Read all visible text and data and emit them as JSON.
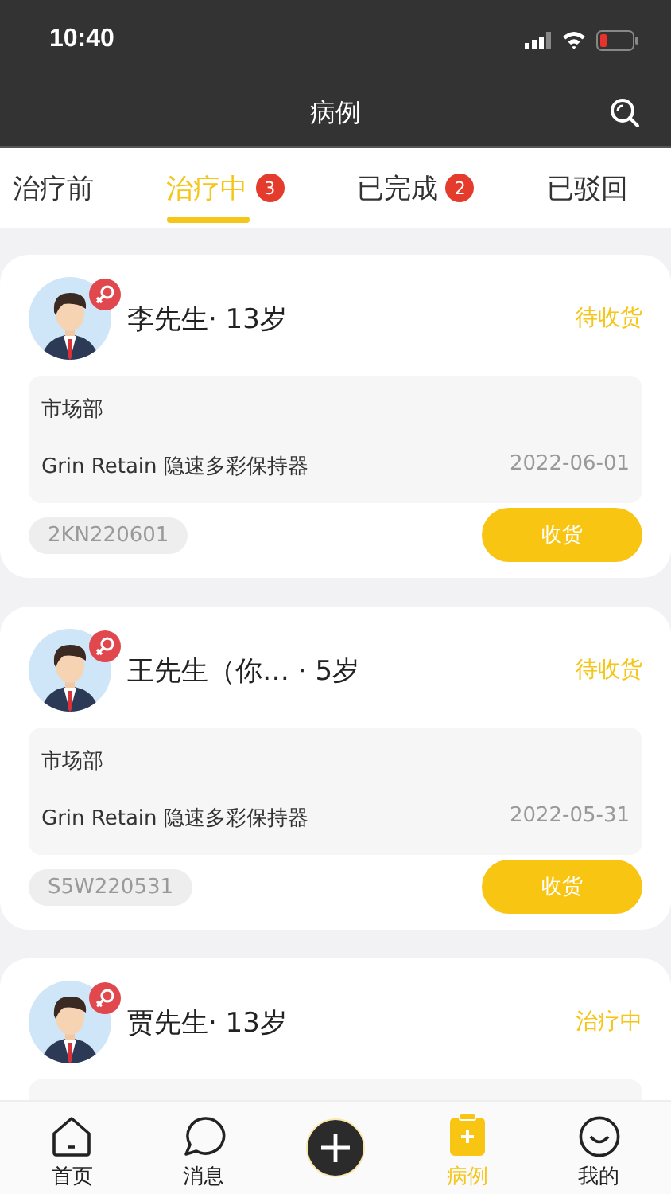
{
  "status_bar": {
    "time": "10:40"
  },
  "nav": {
    "title": "病例"
  },
  "tabs": [
    {
      "label": "治疗前",
      "selected": false
    },
    {
      "label": "治疗中",
      "selected": true,
      "badge": "3"
    },
    {
      "label": "已完成",
      "selected": false,
      "badge": "2"
    },
    {
      "label": "已驳回",
      "selected": false
    }
  ],
  "cases": [
    {
      "title": "李先生· 13岁",
      "status": "待收货",
      "department": "市场部",
      "product": "Grin Retain 隐速多彩保持器",
      "date": "2022-06-01",
      "code": "2KN220601",
      "button": "收货"
    },
    {
      "title": "王先生（你… · 5岁",
      "status": "待收货",
      "department": "市场部",
      "product": "Grin Retain 隐速多彩保持器",
      "date": "2022-05-31",
      "code": "S5W220531",
      "button": "收货"
    },
    {
      "title": "贾先生· 13岁",
      "status": "治疗中"
    }
  ],
  "tab_bar": [
    {
      "label": "首页",
      "kind": "home",
      "selected": false
    },
    {
      "label": "消息",
      "kind": "message",
      "selected": false
    },
    {
      "kind": "add",
      "selected": false
    },
    {
      "label": "病例",
      "kind": "case",
      "selected": true
    },
    {
      "label": "我的",
      "kind": "me",
      "selected": false
    }
  ]
}
